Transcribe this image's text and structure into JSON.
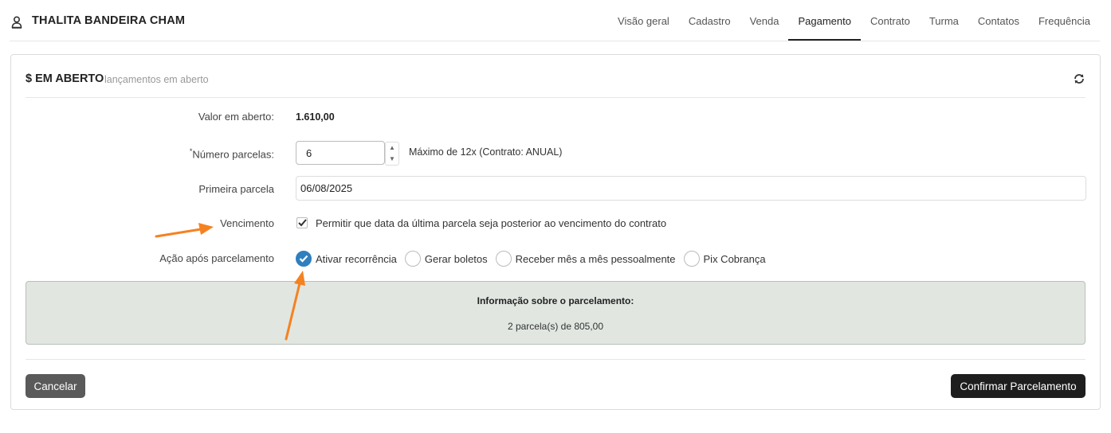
{
  "header": {
    "user_icon": "user-icon",
    "user_name": "THALITA BANDEIRA CHAM",
    "tabs": [
      {
        "label": "Visão geral",
        "active": false
      },
      {
        "label": "Cadastro",
        "active": false
      },
      {
        "label": "Venda",
        "active": false
      },
      {
        "label": "Pagamento",
        "active": true
      },
      {
        "label": "Contrato",
        "active": false
      },
      {
        "label": "Turma",
        "active": false
      },
      {
        "label": "Contatos",
        "active": false
      },
      {
        "label": "Frequência",
        "active": false
      }
    ]
  },
  "card": {
    "title": "$ EM ABERTO",
    "subtitle": "lançamentos em aberto",
    "refresh_icon": "refresh-icon"
  },
  "form": {
    "valor_label": "Valor em aberto:",
    "valor_value": "1.610,00",
    "parcelas_required": "*",
    "parcelas_label": "Número parcelas:",
    "parcelas_value": "6",
    "parcelas_hint": "Máximo de 12x (Contrato: ANUAL)",
    "primeira_label": "Primeira parcela",
    "primeira_value": "06/08/2025",
    "vencimento_label": "Vencimento",
    "vencimento_checkbox_label": "Permitir que data da última parcela seja posterior ao vencimento do contrato",
    "vencimento_checked": true,
    "acao_label": "Ação após parcelamento",
    "acao_options": [
      {
        "label": "Ativar recorrência",
        "checked": true
      },
      {
        "label": "Gerar boletos",
        "checked": false
      },
      {
        "label": "Receber mês a mês pessoalmente",
        "checked": false
      },
      {
        "label": "Pix Cobrança",
        "checked": false
      }
    ]
  },
  "info": {
    "title": "Informação sobre o parcelamento:",
    "text": "2 parcela(s) de 805,00"
  },
  "buttons": {
    "cancel": "Cancelar",
    "confirm": "Confirmar Parcelamento"
  },
  "colors": {
    "accent": "#2f7fbf",
    "arrow": "#f58220",
    "info_bg": "#e1e6e1"
  }
}
